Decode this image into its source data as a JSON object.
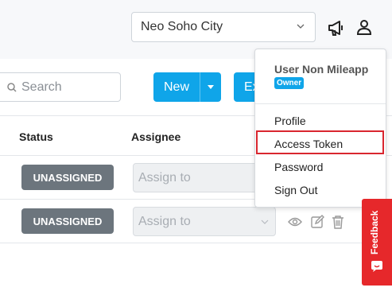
{
  "header": {
    "location_value": "Neo Soho City",
    "icons": [
      "megaphone-icon",
      "user-icon"
    ]
  },
  "toolbar": {
    "search_placeholder": "Search",
    "new_label": "New",
    "export_label_partial": "Ex"
  },
  "table": {
    "columns": [
      "Status",
      "Assignee"
    ],
    "rows": [
      {
        "status": "UNASSIGNED",
        "assignee_placeholder": "Assign to"
      },
      {
        "status": "UNASSIGNED",
        "assignee_placeholder": "Assign to"
      }
    ],
    "row_actions": [
      "eye-icon",
      "edit-icon",
      "trash-icon"
    ]
  },
  "user_menu": {
    "user_name": "User Non Mileapp",
    "role_badge": "Owner",
    "items": [
      "Profile",
      "Access Token",
      "Password",
      "Sign Out"
    ],
    "highlighted_item": "Access Token"
  },
  "feedback": {
    "label": "Feedback"
  },
  "colors": {
    "accent": "#0fa5e9",
    "badge_gray": "#6c757d",
    "highlight_red": "#d9262f",
    "feedback_red": "#e6282b"
  }
}
